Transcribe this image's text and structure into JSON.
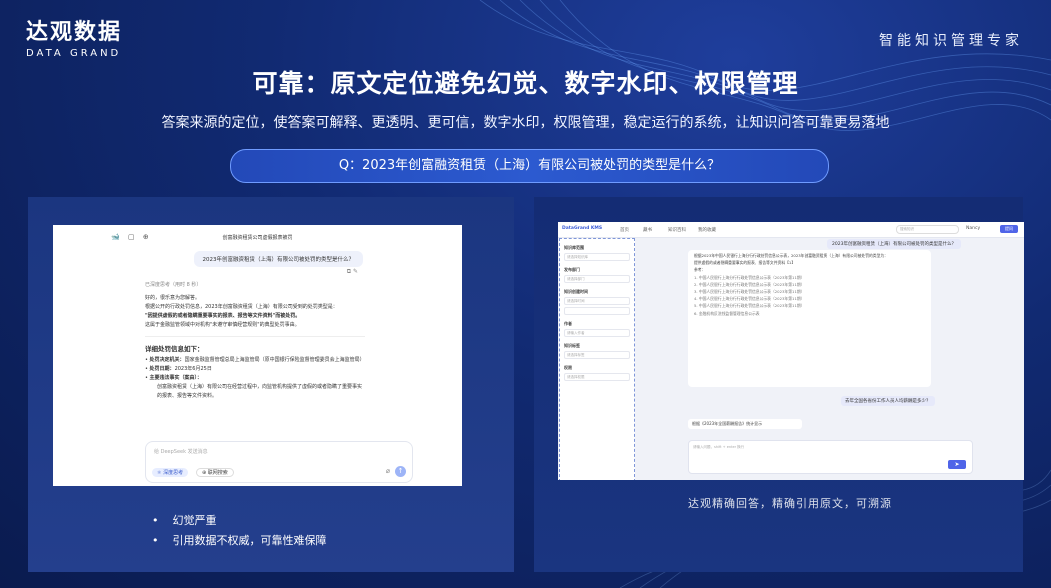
{
  "brand": {
    "name_cn": "达观数据",
    "name_en": "DATA GRAND",
    "tagline": "智能知识管理专家"
  },
  "slide": {
    "title": "可靠：原文定位避免幻觉、数字水印、权限管理",
    "subtitle": "答案来源的定位，使答案可解释、更透明、更可信，数字水印，权限管理，稳定运行的系统，让知识问答可靠更易落地",
    "question": "Q：2023年创富融资租赁（上海）有限公司被处罚的类型是什么？"
  },
  "left_shot": {
    "conversation_title": "创富融资租赁公司虚假报表被罚",
    "user_question": "2023年创富融资租赁（上海）有限公司被处罚的类型是什么？",
    "thinking_label": "已深度思考（用时 8 秒）",
    "answer_lines": [
      "好的，很乐意为您解答。",
      "根据公开的行政处罚信息，2023年创富融资租赁（上海）有限公司受到的处罚类型是：",
      "\"因提供虚假的或者隐瞒重要事实的报表、报告等文件资料\"而被处罚。",
      "这属于金融监管领域中对机构\"未遵守审慎经营规则\"的典型处罚事由。"
    ],
    "details_heading": "详细处罚信息如下：",
    "details": [
      {
        "label": "处罚决定机关：",
        "value": "国家金融监督管理总局上海监管局（原中国银行保险监督管理委员会上海监管局）"
      },
      {
        "label": "处罚日期：",
        "value": "2023年6月25日"
      },
      {
        "label": "主要违法事实（案由）：",
        "value": "创富融资租赁（上海）有限公司在经营过程中，向监管机构提供了虚假的或者隐瞒了重要事实的报表、报告等文件资料。"
      }
    ],
    "input_placeholder": "给 DeepSeek 发送消息",
    "chip_deep": "深度思考",
    "chip_search": "联网搜索"
  },
  "left_bullets": [
    "幻觉严重",
    "引用数据不权威，可靠性难保障"
  ],
  "right_shot": {
    "app_name": "DataGrand KMS",
    "nav": [
      "首页",
      "藏书",
      "知识百科",
      "我的收藏"
    ],
    "search_placeholder": "搜索知识",
    "user": "Nancy",
    "top_button": "提问",
    "side_sections": [
      {
        "title": "知识库范围",
        "box": "请选择知识库"
      },
      {
        "title": "发布部门",
        "box": "请选择部门"
      },
      {
        "title": "知识创建时间",
        "box": "请选择时间"
      },
      {
        "title": "作者",
        "box": "请输入作者"
      },
      {
        "title": "知识标签",
        "box": "请选择标签"
      },
      {
        "title": "权限",
        "box": "请选择权限"
      }
    ],
    "question": "2023年创富融资租赁（上海）有限公司被处罚的类型是什么？",
    "answer_lines": [
      "根据2023年中国人民银行上海分行行政处罚信息公示表，2023年创富融资租赁（上海）有限公司被处罚的类型为：",
      "提供虚假的或者隐瞒重要事实的报表、报告等文件资料【1】",
      "参考：",
      "1. 中国人民银行上海分行行政处罚信息公示表（2023年第11期）",
      "2. 中国人民银行上海分行行政处罚信息公示表（2023年第11期）",
      "3. 中国人民银行上海分行行政处罚信息公示表（2023年第11期）",
      "4. 中国人民银行上海分行行政处罚信息公示表（2023年第11期）",
      "5. 中国人民银行上海分行行政处罚信息公示表（2023年第11期）",
      "6. 金融机构反洗钱监督管理信息公示表"
    ],
    "follow_question": "去年全国各省份工作人员人均薪酬是多少？",
    "follow_answer": "根据《2023年全国薪酬报告》统计显示",
    "input_placeholder": "请输入问题，shift + enter 换行"
  },
  "right_caption": "达观精确回答，精确引用原文，可溯源"
}
